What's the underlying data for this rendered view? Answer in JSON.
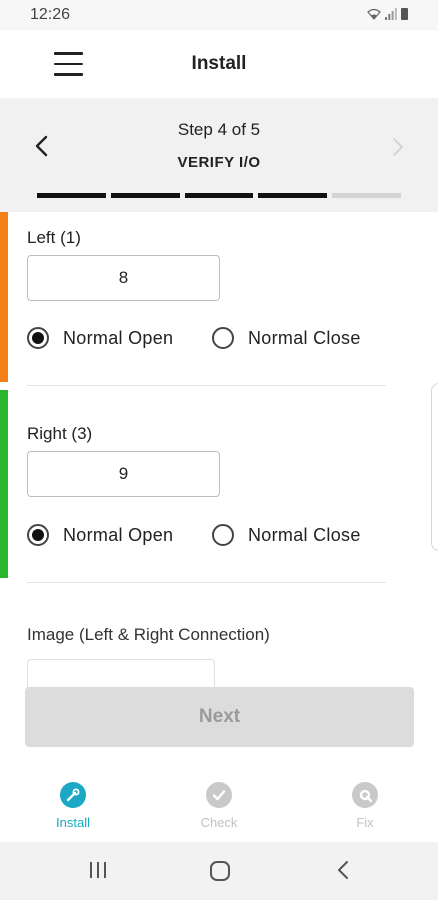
{
  "status_bar": {
    "time": "12:26"
  },
  "app_bar": {
    "title": "Install"
  },
  "stepper": {
    "step_text": "Step 4 of 5",
    "step_name": "VERIFY I/O",
    "completed_steps": 4,
    "total_steps": 5
  },
  "sections": [
    {
      "label": "Left (1)",
      "value": "8",
      "bar_color": "#f57f17",
      "option_1": "Normal Open",
      "option_2": "Normal Close",
      "selected": "Normal Open"
    },
    {
      "label": "Right (3)",
      "value": "9",
      "bar_color": "#2bb52b",
      "option_1": "Normal Open",
      "option_2": "Normal Close",
      "selected": "Normal Open"
    }
  ],
  "image_section": {
    "label": "Image (Left & Right Connection)"
  },
  "next_button": {
    "label": "Next"
  },
  "bottom_nav": {
    "items": [
      {
        "label": "Install",
        "icon": "wrench-icon",
        "active": true
      },
      {
        "label": "Check",
        "icon": "checkmark-icon",
        "active": false
      },
      {
        "label": "Fix",
        "icon": "wrench-gear-icon",
        "active": false
      }
    ],
    "accent_color": "#1ba8c4"
  }
}
